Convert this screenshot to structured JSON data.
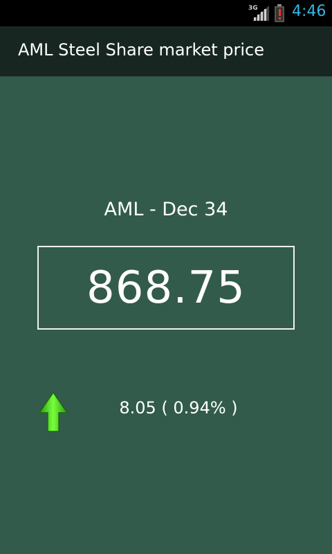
{
  "status_bar": {
    "network_label": "3G",
    "time": "4:46",
    "time_color": "#33b5e5",
    "icons": [
      "signal-icon",
      "battery-alert-icon"
    ]
  },
  "app": {
    "title": "AML Steel Share market price",
    "title_bar_color": "#172621",
    "background_color": "#325b4b"
  },
  "quote": {
    "symbol_label": "AML - Dec 34",
    "price": "868.75",
    "change": "8.05 ( 0.94% )",
    "direction": "up",
    "direction_icon": "up-arrow-icon",
    "direction_color": "#44dd22"
  }
}
